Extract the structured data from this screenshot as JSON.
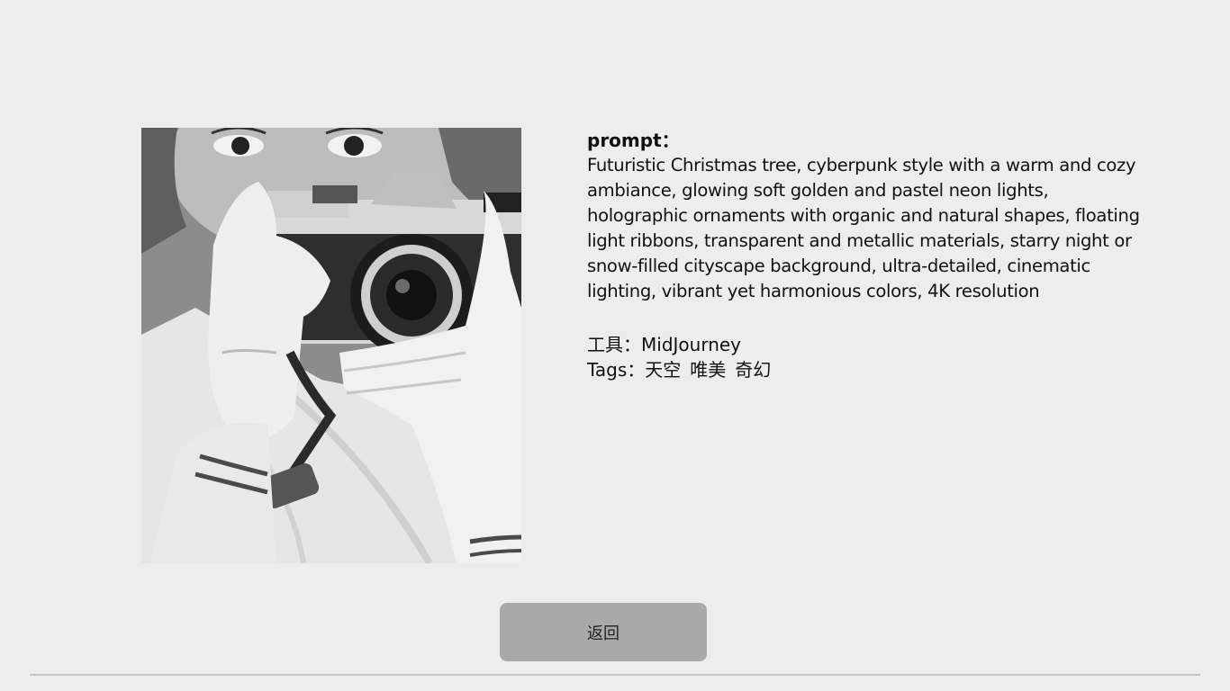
{
  "prompt": {
    "label": "prompt：",
    "text": "Futuristic Christmas tree, cyberpunk style with a warm and cozy ambiance, glowing soft golden and pastel neon lights, holographic ornaments with organic and natural shapes, floating light ribbons, transparent and metallic materials, starry night or snow-filled cityscape background, ultra-detailed, cinematic lighting, vibrant yet harmonious colors, 4K resolution"
  },
  "tool": {
    "label": "工具：",
    "value": "MidJourney"
  },
  "tags": {
    "label": "Tags：",
    "items": [
      "天空",
      "唯美",
      "奇幻"
    ]
  },
  "back_button": {
    "label": "返回"
  },
  "colors": {
    "background": "#ededed",
    "button": "#a9a9a9",
    "divider": "#c4c4c4"
  }
}
